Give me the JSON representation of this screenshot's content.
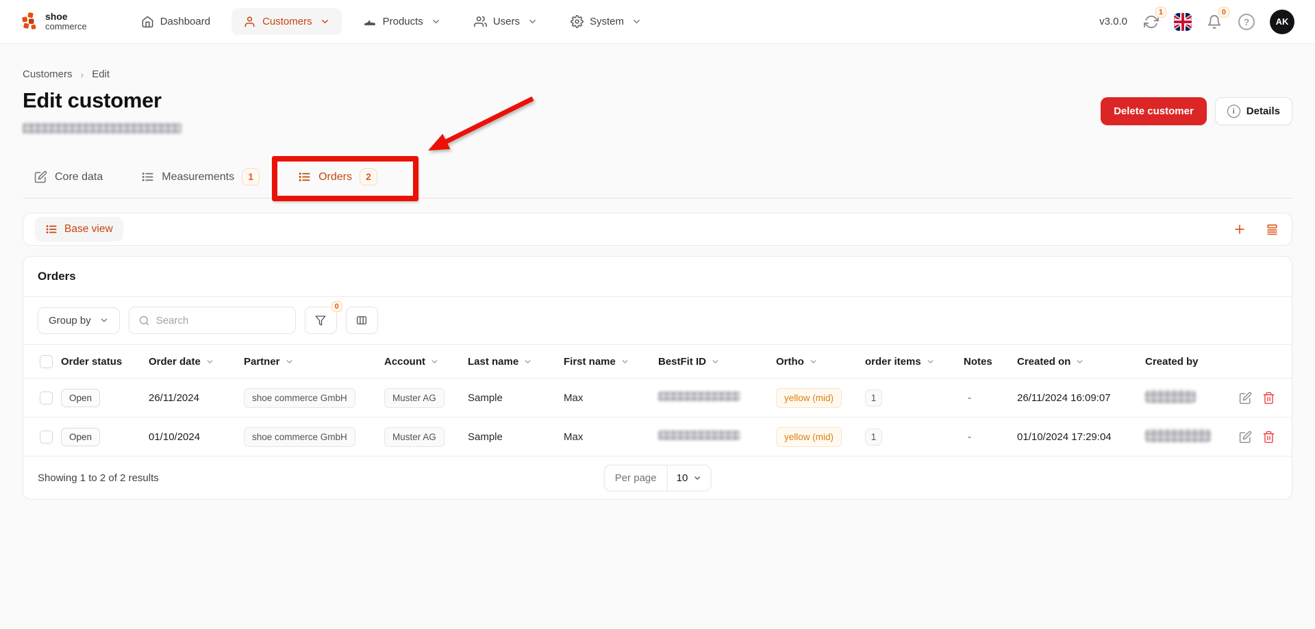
{
  "colors": {
    "accent": "#c9440d",
    "accent_underline": "#b8400b",
    "badge_text": "#ea580c",
    "badge_bg": "#fff7ed",
    "badge_border": "#fed7aa",
    "delete_red": "#dc2626",
    "annotation_red": "#ea1207",
    "avatar_bg": "#131316"
  },
  "topbar": {
    "logo_line1": "shoe",
    "logo_line2": "commerce",
    "items": [
      {
        "label": "Dashboard",
        "icon": "home-icon",
        "active": false,
        "chevron": false
      },
      {
        "label": "Customers",
        "icon": "user-icon",
        "active": true,
        "chevron": true
      },
      {
        "label": "Products",
        "icon": "shoe-icon",
        "active": false,
        "chevron": true
      },
      {
        "label": "Users",
        "icon": "users-icon",
        "active": false,
        "chevron": true
      },
      {
        "label": "System",
        "icon": "gear-icon",
        "active": false,
        "chevron": true
      }
    ],
    "version": "v3.0.0",
    "sync_badge": "1",
    "bell_badge": "0",
    "avatar_initials": "AK"
  },
  "page": {
    "breadcrumb": [
      "Customers",
      "Edit"
    ],
    "title": "Edit customer",
    "subtitle_redacted": true,
    "delete_button": "Delete customer",
    "details_button": "Details"
  },
  "tabs": [
    {
      "label": "Core data",
      "icon": "pencil-icon",
      "badge": null,
      "active": false
    },
    {
      "label": "Measurements",
      "icon": "list-icon",
      "badge": "1",
      "active": false
    },
    {
      "label": "Orders",
      "icon": "list-icon",
      "badge": "2",
      "active": true,
      "annotated": true
    }
  ],
  "view_bar": {
    "current_view": "Base view"
  },
  "orders_panel": {
    "title": "Orders",
    "group_by_label": "Group by",
    "search_placeholder": "Search",
    "filter_badge": "0",
    "columns": [
      {
        "type": "checkbox",
        "label": ""
      },
      {
        "label": "Order status",
        "sortable": false
      },
      {
        "label": "Order date",
        "sortable": true
      },
      {
        "label": "Partner",
        "sortable": true
      },
      {
        "label": "Account",
        "sortable": true
      },
      {
        "label": "Last name",
        "sortable": true
      },
      {
        "label": "First name",
        "sortable": true
      },
      {
        "label": "BestFit ID",
        "sortable": true
      },
      {
        "label": "Ortho",
        "sortable": true
      },
      {
        "label": "order items",
        "sortable": true
      },
      {
        "label": "Notes",
        "sortable": false
      },
      {
        "label": "Created on",
        "sortable": true
      },
      {
        "label": "Created by",
        "sortable": false
      },
      {
        "type": "actions",
        "label": ""
      }
    ],
    "rows": [
      {
        "order_status": "Open",
        "order_date": "26/11/2024",
        "partner": "shoe commerce GmbH",
        "account": "Muster AG",
        "last_name": "Sample",
        "first_name": "Max",
        "bestfit_id_redacted": true,
        "ortho": "yellow (mid)",
        "order_items": "1",
        "notes": "-",
        "created_on": "26/11/2024 16:09:07",
        "created_by_redacted": true
      },
      {
        "order_status": "Open",
        "order_date": "01/10/2024",
        "partner": "shoe commerce GmbH",
        "account": "Muster AG",
        "last_name": "Sample",
        "first_name": "Max",
        "bestfit_id_redacted": true,
        "ortho": "yellow (mid)",
        "order_items": "1",
        "notes": "-",
        "created_on": "01/10/2024 17:29:04",
        "created_by_redacted": true
      }
    ],
    "footer": {
      "summary": "Showing 1 to 2 of 2 results",
      "per_page_label": "Per page",
      "per_page_value": "10"
    }
  }
}
